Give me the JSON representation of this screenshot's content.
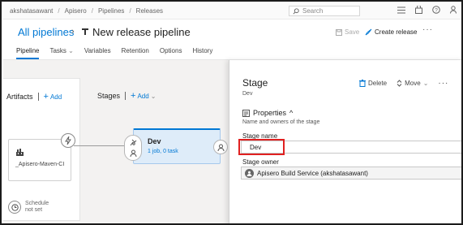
{
  "breadcrumbs": [
    "akshatasawant",
    "Apisero",
    "Pipelines",
    "Releases"
  ],
  "search": {
    "placeholder": "Search"
  },
  "header": {
    "all_pipelines": "All pipelines",
    "title": "New release pipeline",
    "save_label": "Save",
    "create_release_label": "Create release",
    "more_label": "···"
  },
  "tabs": [
    {
      "label": "Pipeline",
      "active": true
    },
    {
      "label": "Tasks",
      "has_dropdown": true
    },
    {
      "label": "Variables"
    },
    {
      "label": "Retention"
    },
    {
      "label": "Options"
    },
    {
      "label": "History"
    }
  ],
  "artifacts": {
    "heading": "Artifacts",
    "add_label": "Add",
    "artifact_name": "_Apisero-Maven-CI",
    "schedule_label": "Schedule not set"
  },
  "stages": {
    "heading": "Stages",
    "add_label": "Add",
    "stage": {
      "name": "Dev",
      "summary": "1 job, 0 task"
    }
  },
  "panel": {
    "title": "Stage",
    "subtitle": "Dev",
    "delete_label": "Delete",
    "move_label": "Move",
    "more_label": "···",
    "properties_label": "Properties",
    "properties_desc": "Name and owners of the stage",
    "stage_name_label": "Stage name",
    "stage_name_value": "Dev",
    "stage_owner_label": "Stage owner",
    "stage_owner_value": "Apisero Build Service (akshatasawant)"
  },
  "colors": {
    "accent": "#0078d4",
    "highlight": "#e02020",
    "stage_fill": "#deecf9"
  }
}
